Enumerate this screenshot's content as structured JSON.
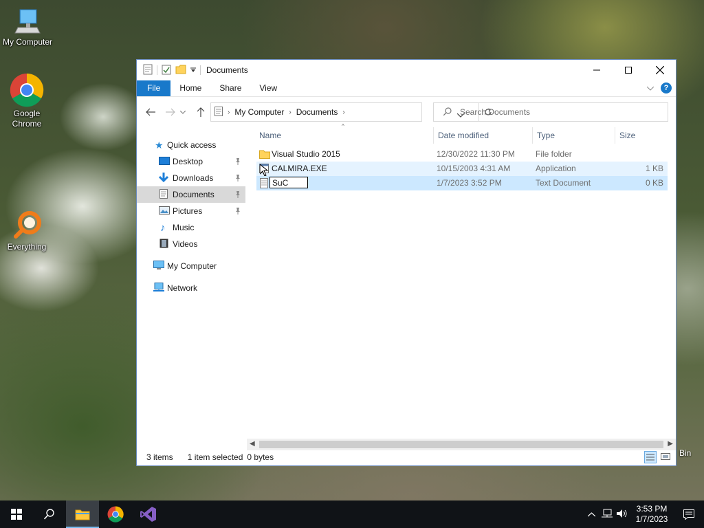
{
  "desktop": {
    "icons": [
      {
        "label": "My Computer",
        "icon": "computer-icon"
      },
      {
        "label": "Google Chrome",
        "icon": "chrome-icon"
      },
      {
        "label": "Everything",
        "icon": "everything-search-icon"
      }
    ],
    "recycle_bin_partial_label": "Bin"
  },
  "window": {
    "title": "Documents",
    "ribbon_tabs": [
      "File",
      "Home",
      "Share",
      "View"
    ],
    "address": {
      "segments": [
        "My Computer",
        "Documents"
      ]
    },
    "search_placeholder": "Search Documents",
    "nav_pane": {
      "quick_access": "Quick access",
      "items": [
        {
          "label": "Desktop",
          "pinned": true
        },
        {
          "label": "Downloads",
          "pinned": true
        },
        {
          "label": "Documents",
          "pinned": true,
          "selected": true
        },
        {
          "label": "Pictures",
          "pinned": true
        },
        {
          "label": "Music",
          "pinned": false
        },
        {
          "label": "Videos",
          "pinned": false
        }
      ],
      "my_computer": "My Computer",
      "network": "Network"
    },
    "columns": {
      "name": "Name",
      "date": "Date modified",
      "type": "Type",
      "size": "Size"
    },
    "files": [
      {
        "name": "Visual Studio 2015",
        "date": "12/30/2022 11:30 PM",
        "type": "File folder",
        "size": "",
        "icon": "folder-icon"
      },
      {
        "name": "CALMIRA.EXE",
        "date": "10/15/2003 4:31 AM",
        "type": "Application",
        "size": "1 KB",
        "icon": "application-icon"
      },
      {
        "name": "SuC",
        "date": "1/7/2023 3:52 PM",
        "type": "Text Document",
        "size": "0 KB",
        "icon": "text-document-icon",
        "renaming": true
      }
    ],
    "status": {
      "count": "3 items",
      "selected": "1 item selected",
      "bytes": "0 bytes"
    }
  },
  "taskbar": {
    "time": "3:53 PM",
    "date": "1/7/2023"
  }
}
